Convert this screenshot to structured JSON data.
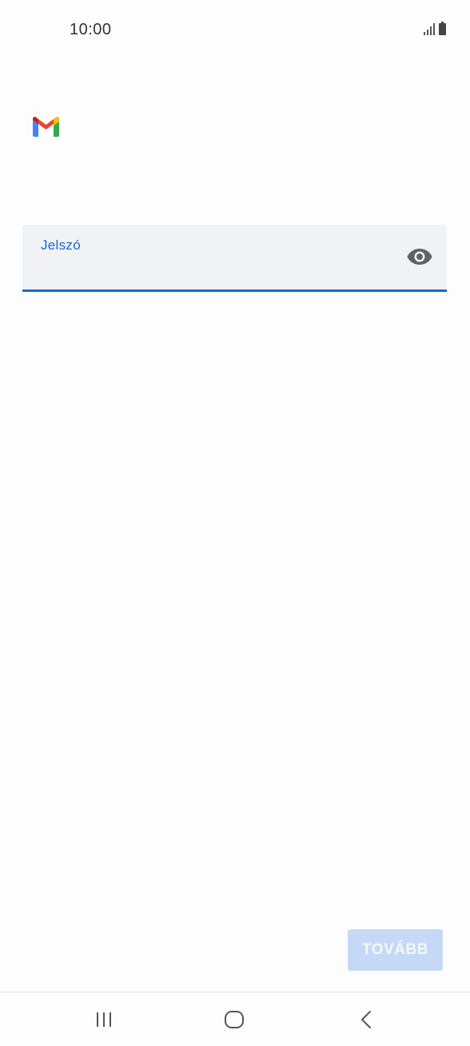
{
  "status_bar": {
    "time": "10:00",
    "icons": [
      "signal-icon",
      "battery-icon"
    ]
  },
  "app": {
    "logo": "gmail-logo-icon",
    "colors": {
      "blue": "#4285F4",
      "red": "#EA4335",
      "yellow": "#FBBC04",
      "green": "#34A853"
    }
  },
  "password_field": {
    "label": "Jelszó",
    "value": "",
    "accent_color": "#1a66d2",
    "toggle_icon": "eye-icon"
  },
  "next_button": {
    "label": "TOVÁBB",
    "enabled": false
  },
  "nav_bar": {
    "items": [
      "recent-apps-icon",
      "home-icon",
      "back-icon"
    ]
  }
}
